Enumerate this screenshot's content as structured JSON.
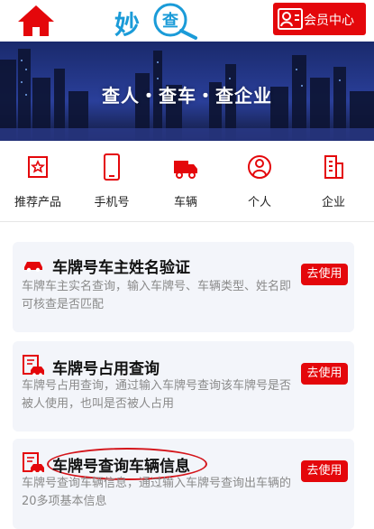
{
  "header": {
    "logo_text": "妙",
    "logo_mark_char": "查",
    "member_label": "会员中心"
  },
  "banner": {
    "title": "查人・查车・查企业"
  },
  "nav": {
    "items": [
      {
        "label": "推荐产品",
        "icon": "recommend-icon"
      },
      {
        "label": "手机号",
        "icon": "phone-icon"
      },
      {
        "label": "车辆",
        "icon": "truck-icon"
      },
      {
        "label": "个人",
        "icon": "person-icon"
      },
      {
        "label": "企业",
        "icon": "building-icon"
      }
    ]
  },
  "cards": [
    {
      "title": "车牌号车主姓名验证",
      "desc": "车牌车主实名查询，输入车牌号、车辆类型、姓名即可核查是否匹配",
      "button": "去使用",
      "icon": "car-icon"
    },
    {
      "title": "车牌号占用查询",
      "desc": "车牌号占用查询，通过输入车牌号查询该车牌号是否被人使用，也叫是否被人占用",
      "button": "去使用",
      "icon": "vehicle-doc-icon"
    },
    {
      "title": "车牌号查询车辆信息",
      "desc": "车牌号查询车辆信息，通过输入车牌号查询出车辆的20多项基本信息",
      "button": "去使用",
      "icon": "vehicle-doc-icon"
    }
  ],
  "colors": {
    "brand_red": "#e4070b",
    "logo_blue": "#1a9bd8",
    "card_bg": "#f3f5fa",
    "desc_gray": "#8a8a8a"
  }
}
